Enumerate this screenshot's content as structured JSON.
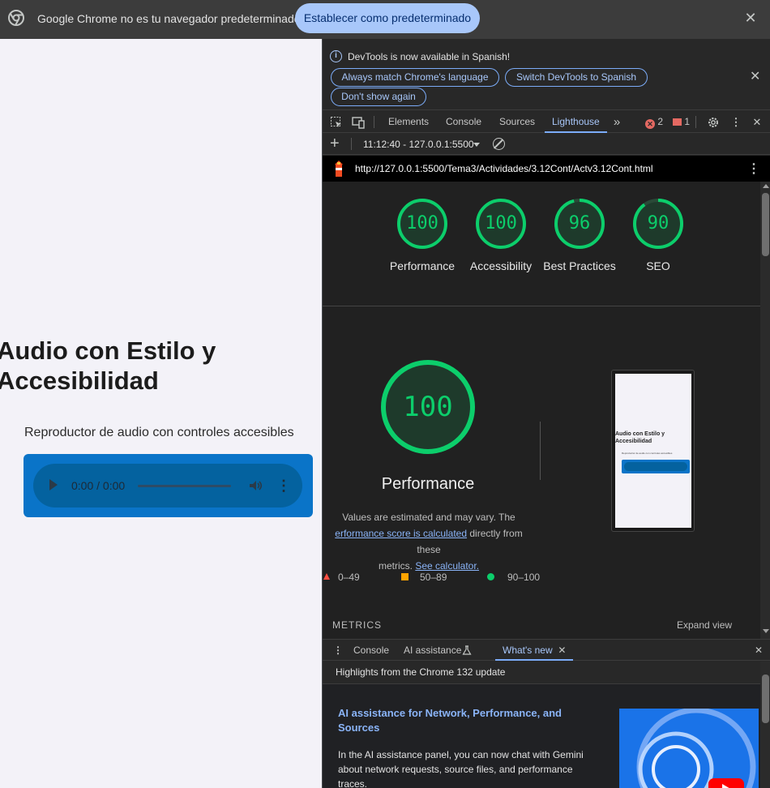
{
  "infobar": {
    "message": "Google Chrome no es tu navegador predeterminado",
    "set_default_label": "Establecer como predeterminado",
    "close_glyph": "✕"
  },
  "page": {
    "heading": "Audio con Estilo y Accesibilidad",
    "subtitle": "Reproductor de audio con controles accesibles",
    "player_time": "0:00 / 0:00",
    "player_more": "⋮",
    "colors": {
      "background": "#f3f2f8",
      "player_box": "#0a74c8"
    }
  },
  "devtools": {
    "language_bar": {
      "message": "DevTools is now available in Spanish!",
      "always_match_label": "Always match Chrome's language",
      "switch_label": "Switch DevTools to Spanish",
      "dont_show_label": "Don't show again",
      "close_glyph": "✕"
    },
    "tabs": {
      "elements": "Elements",
      "console": "Console",
      "sources": "Sources",
      "lighthouse": "Lighthouse",
      "more": "»",
      "errors_count": "2",
      "issues_count": "1"
    },
    "lighthouse_toolbar": {
      "report_selector": "11:12:40 - 127.0.0.1:5500"
    },
    "report_url": "http://127.0.0.1:5500/Tema3/Actividades/3.12Cont/Actv3.12Cont.html",
    "scores": [
      {
        "label": "Performance",
        "value": "100",
        "fraction": 1.0
      },
      {
        "label": "Accessibility",
        "value": "100",
        "fraction": 1.0
      },
      {
        "label": "Best Practices",
        "value": "96",
        "fraction": 0.96
      },
      {
        "label": "SEO",
        "value": "90",
        "fraction": 0.9
      }
    ],
    "main_score": {
      "value": "100",
      "label": "Performance",
      "fraction": 1.0
    },
    "note": {
      "line1": "Values are estimated and may vary. The",
      "link1": "erformance score is calculated",
      "line2_rest": " directly from these",
      "line3": "metrics. ",
      "link2": "See calculator."
    },
    "legend": {
      "fail": "0–49",
      "average": "50–89",
      "pass": "90–100"
    },
    "metrics_label": "METRICS",
    "expand_label": "Expand view",
    "screenshot_thumbnail": {
      "title": "Audio con Estilo y Accesibilidad",
      "subtitle": "Reproductor de audio con controles accesibles"
    },
    "drawer": {
      "console_tab": "Console",
      "ai_tab": "AI assistance",
      "whats_new_tab": "What's new",
      "highlights": "Highlights from the Chrome 132 update",
      "card_title": "AI assistance for Network, Performance, and Sources",
      "card_text": "In the AI assistance panel, you can now chat with Gemini about network requests, source files, and performance traces."
    },
    "colors": {
      "pass": "#0cce6b",
      "average": "#ffa400",
      "fail": "#ff4e42",
      "accent": "#a8c7fa"
    }
  }
}
